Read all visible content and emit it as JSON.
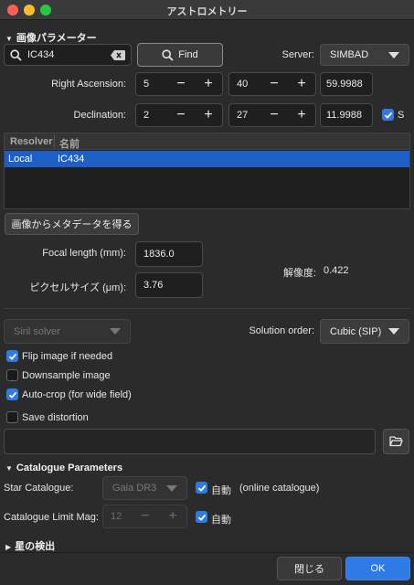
{
  "window": {
    "title": "アストロメトリー"
  },
  "image_params": {
    "section_title": "画像パラメーター",
    "search_value": "IC434",
    "find_label": "Find",
    "server_label": "Server:",
    "server_value": "SIMBAD",
    "ra_label": "Right Ascension:",
    "ra_h": "5",
    "ra_m": "40",
    "ra_s": "59.9988",
    "dec_label": "Declination:",
    "dec_d": "2",
    "dec_m": "27",
    "dec_s": "11.9988",
    "south_label": "S",
    "table_headers": [
      "Resolver",
      "名前"
    ],
    "table_rows": [
      {
        "resolver": "Local",
        "name": "IC434"
      }
    ],
    "metadata_button": "画像からメタデータを得る",
    "focal_label": "Focal length (mm):",
    "focal_value": "1836.0",
    "pixel_label": "ピクセルサイズ (μm):",
    "pixel_value": "3.76",
    "resolution_label": "解像度:",
    "resolution_value": "0.422"
  },
  "solver": {
    "solver_value": "Siril solver",
    "order_label": "Solution order:",
    "order_value": "Cubic (SIP)",
    "flip_label": "Flip image if needed",
    "flip_checked": true,
    "downsample_label": "Downsample image",
    "downsample_checked": false,
    "autocrop_label": "Auto-crop (for wide field)",
    "autocrop_checked": true,
    "save_distortion_label": "Save distortion",
    "save_distortion_checked": false,
    "distortion_path": ""
  },
  "catalogue": {
    "section_title": "Catalogue Parameters",
    "star_catalogue_label": "Star Catalogue:",
    "star_catalogue_value": "Gaia DR3",
    "auto_label": "自動",
    "online_label": "(online catalogue)",
    "limit_label": "Catalogue Limit Mag:",
    "limit_value": "12",
    "limit_auto_label": "自動"
  },
  "star_detection": {
    "section_title": "星の検出"
  },
  "footer": {
    "close_label": "閉じる",
    "ok_label": "OK"
  },
  "colors": {
    "accent": "#2f7ae5",
    "selection": "#1d5ec7",
    "background": "#2b2b2b"
  }
}
